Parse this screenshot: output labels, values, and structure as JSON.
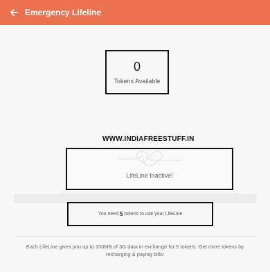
{
  "header": {
    "title": "Emergency Lifeline",
    "back_icon": "arrow-left-icon",
    "color": "#ec7151"
  },
  "tokens": {
    "count": "0",
    "label": "Tokens Available"
  },
  "watermark": "WWW.INDIAFREESTUFF.IN",
  "lifeline": {
    "icon": "heart-pulse-icon",
    "status": "LifeLine Inactive!"
  },
  "requirement": {
    "prefix": "You need",
    "count": "5",
    "suffix": "tokens to use your LifeLine"
  },
  "footer": {
    "text": "Each LifeLine gives you up to 100MB of 3G data in exchange for 5 tokens. Get more tokens by recharging & paying bills!"
  }
}
